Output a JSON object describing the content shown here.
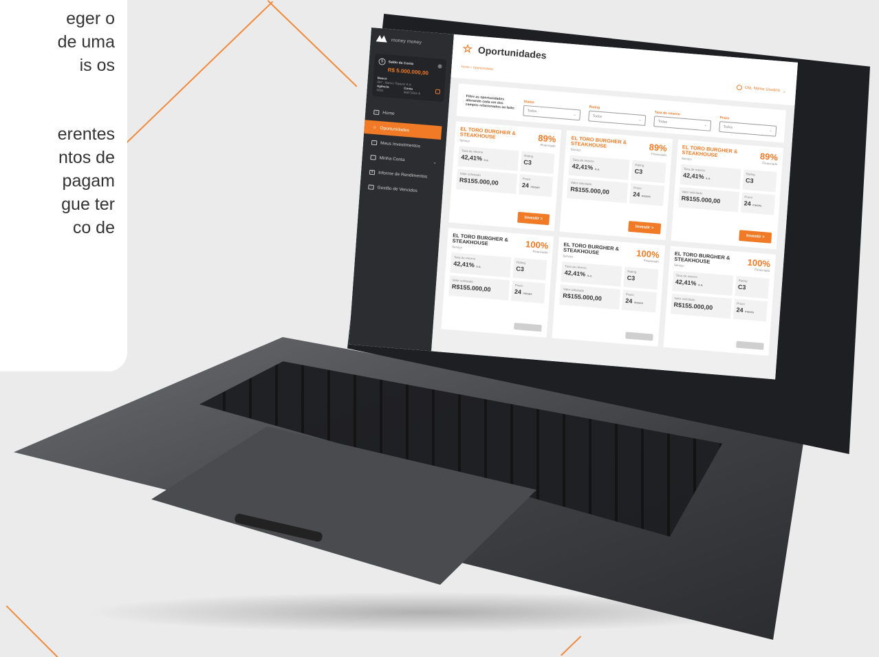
{
  "background_text": {
    "line1": "eger o",
    "line2": "de uma",
    "line3": "is os",
    "line4": "erentes",
    "line5": "ntos de",
    "line6": "pagam",
    "line7": "gue ter",
    "line8": "co de"
  },
  "app": {
    "brand": "money money",
    "balance_label": "Saldo da Conta",
    "balance_value": "R$ 5.000.000,00",
    "bank_label": "Banco",
    "bank_value": "067 - Banco Topázio S.A",
    "agency_label": "Agência",
    "agency_value": "0001",
    "account_label": "Conta",
    "account_value": "96871641-8"
  },
  "sidebar": {
    "items": [
      {
        "label": "Home",
        "icon": "home-icon"
      },
      {
        "label": "Oportunidades",
        "icon": "star-icon",
        "active": true
      },
      {
        "label": "Meus Investimentos",
        "icon": "chart-icon"
      },
      {
        "label": "Minha Conta",
        "icon": "wallet-icon"
      },
      {
        "label": "Informe de Rendimentos",
        "icon": "document-icon"
      },
      {
        "label": "Gestão de Vencidos",
        "icon": "calendar-icon"
      }
    ]
  },
  "header": {
    "title": "Oportunidades",
    "breadcrumb": "Home > Oportunidades",
    "user_greeting": "Olá, Nome Usuário"
  },
  "filters": {
    "hint": "Filtre as oportunidades alterando cada um dos campos relacionados ao lado:",
    "items": [
      {
        "label": "Status",
        "value": "Todos"
      },
      {
        "label": "Rating",
        "value": "Todos"
      },
      {
        "label": "Taxa de retorno",
        "value": "Todas"
      },
      {
        "label": "Prazo",
        "value": "Todos"
      }
    ]
  },
  "cards": [
    {
      "name": "EL TORO BURGHER & STEAKHOUSE",
      "category": "Serviço",
      "percent": "89%",
      "percent_label": "Financiado",
      "rate_label": "Taxa de retorno",
      "rate": "42,41%",
      "rate_unit": "a.a.",
      "rating_label": "Rating",
      "rating": "C3",
      "amount_label": "Valor solicitado",
      "amount": "R$155.000,00",
      "term_label": "Prazo",
      "term": "24",
      "term_unit": "meses",
      "button": "Investir >"
    },
    {
      "name": "EL TORO BURGHER & STEAKHOUSE",
      "category": "Serviço",
      "percent": "89%",
      "percent_label": "Financiado",
      "rate_label": "Taxa de retorno",
      "rate": "42,41%",
      "rate_unit": "a.a.",
      "rating_label": "Rating",
      "rating": "C3",
      "amount_label": "Valor solicitado",
      "amount": "R$155.000,00",
      "term_label": "Prazo",
      "term": "24",
      "term_unit": "meses",
      "button": "Investir >"
    },
    {
      "name": "EL TORO BURGHER & STEAKHOUSE",
      "category": "Serviço",
      "percent": "89%",
      "percent_label": "Financiado",
      "rate_label": "Taxa de retorno",
      "rate": "42,41%",
      "rate_unit": "a.a.",
      "rating_label": "Rating",
      "rating": "C3",
      "amount_label": "Valor solicitado",
      "amount": "R$155.000,00",
      "term_label": "Prazo",
      "term": "24",
      "term_unit": "meses",
      "button": "Investir >"
    },
    {
      "name": "EL TORO BURGHER & STEAKHOUSE",
      "category": "Serviço",
      "percent": "100%",
      "percent_label": "Financiado",
      "rate_label": "Taxa de retorno",
      "rate": "42,41%",
      "rate_unit": "a.a.",
      "rating_label": "Rating",
      "rating": "C3",
      "amount_label": "Valor solicitado",
      "amount": "R$155.000,00",
      "term_label": "Prazo",
      "term": "24",
      "term_unit": "meses",
      "button": ""
    },
    {
      "name": "EL TORO BURGHER & STEAKHOUSE",
      "category": "Serviço",
      "percent": "100%",
      "percent_label": "Financiado",
      "rate_label": "Taxa de retorno",
      "rate": "42,41%",
      "rate_unit": "a.a.",
      "rating_label": "Rating",
      "rating": "C3",
      "amount_label": "Valor solicitado",
      "amount": "R$155.000,00",
      "term_label": "Prazo",
      "term": "24",
      "term_unit": "meses",
      "button": ""
    },
    {
      "name": "EL TORO BURGHER & STEAKHOUSE",
      "category": "Serviço",
      "percent": "100%",
      "percent_label": "Financiado",
      "rate_label": "Taxa de retorno",
      "rate": "42,41%",
      "rate_unit": "a.a.",
      "rating_label": "Rating",
      "rating": "C3",
      "amount_label": "Valor solicitado",
      "amount": "R$155.000,00",
      "term_label": "Prazo",
      "term": "24",
      "term_unit": "meses",
      "button": ""
    }
  ],
  "colors": {
    "accent": "#f07a25",
    "sidebar_bg": "#2c2d30",
    "page_bg": "#ebebeb"
  }
}
